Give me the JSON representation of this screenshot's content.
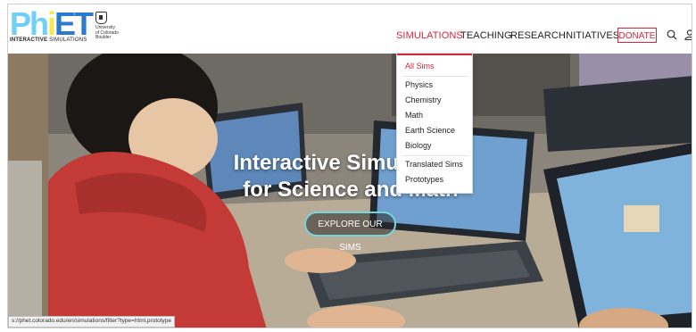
{
  "logo": {
    "ph": "Ph",
    "h": "i",
    "et": "ET",
    "subtitle_bold": "INTERACTIVE",
    "subtitle_rest": " SIMULATIONS"
  },
  "cu_logo": {
    "text": "University\nof Colorado\nBoulder"
  },
  "nav": {
    "simulations": "SIMULATIONS",
    "teaching": "TEACHING",
    "research": "RESEARCH",
    "initiatives": "INITIATIVES",
    "donate": "DONATE"
  },
  "dropdown": {
    "items": [
      "All Sims",
      "Physics",
      "Chemistry",
      "Math",
      "Earth Science",
      "Biology",
      "Translated Sims",
      "Prototypes"
    ]
  },
  "hero": {
    "title_line1": "Interactive Simulations",
    "title_line2": "for Science and Math",
    "cta": "EXPLORE OUR SIMS"
  },
  "status_bar": {
    "url": "s://phet.colorado.edu/en/simulations/filter?type=html,prototype"
  },
  "colors": {
    "accent": "#d7263d",
    "button_outline": "#78d5e0",
    "logo_blue": "#2a7bd0",
    "logo_yellow": "#f6e84e",
    "logo_cyan": "#6fcff6"
  }
}
